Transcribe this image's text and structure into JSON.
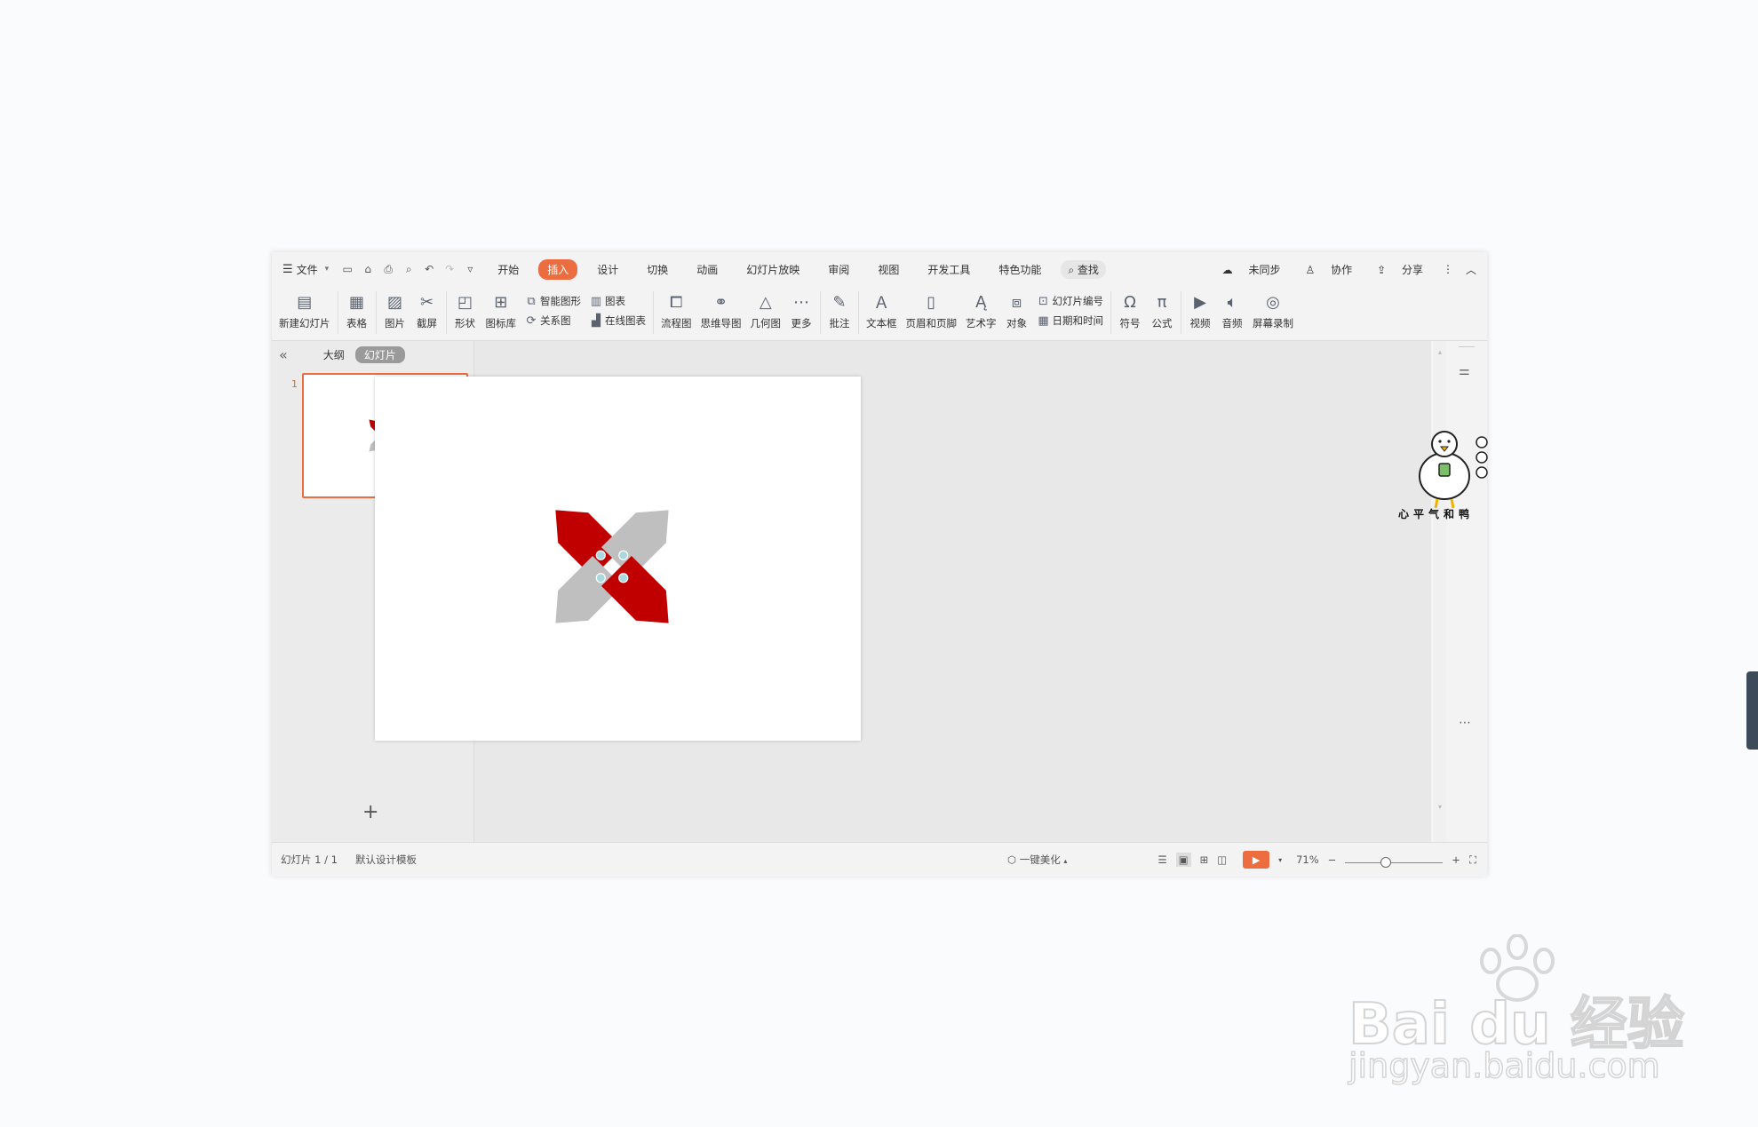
{
  "menubar": {
    "file_label": "文件",
    "tabs": [
      "开始",
      "插入",
      "设计",
      "切换",
      "动画",
      "幻灯片放映",
      "审阅",
      "视图",
      "开发工具",
      "特色功能"
    ],
    "active_tab": "插入",
    "search_label": "查找",
    "right": {
      "sync": "未同步",
      "collab": "协作",
      "share": "分享"
    }
  },
  "ribbon": {
    "new_slide": "新建幻灯片",
    "table": "表格",
    "picture": "图片",
    "screenshot": "截屏",
    "shape": "形状",
    "icon_lib": "图标库",
    "smart_graphic": "智能图形",
    "relation": "关系图",
    "chart": "图表",
    "online_chart": "在线图表",
    "flowchart": "流程图",
    "mindmap": "思维导图",
    "geometry": "几何图",
    "more": "更多",
    "comment": "批注",
    "textbox": "文本框",
    "header_footer": "页眉和页脚",
    "wordart": "艺术字",
    "object": "对象",
    "slide_number": "幻灯片编号",
    "datetime": "日期和时间",
    "symbol": "符号",
    "formula": "公式",
    "video": "视频",
    "audio": "音频",
    "screen_record": "屏幕录制"
  },
  "left_panel": {
    "outline_tab": "大纲",
    "slides_tab": "幻灯片",
    "thumb_number": "1"
  },
  "mascot": {
    "caption": "心平气和鸭"
  },
  "status": {
    "slide_count": "幻灯片 1 / 1",
    "template": "默认设计模板",
    "beautify": "一键美化",
    "zoom": "71%"
  },
  "watermark": {
    "brand": "Bai du 经验",
    "url": "jingyan.baidu.com"
  },
  "colors": {
    "accent": "#ec6d3f",
    "tag_red": "#c00000",
    "tag_gray": "#bfbfbf",
    "tag_hole": "#a9d8e0"
  }
}
